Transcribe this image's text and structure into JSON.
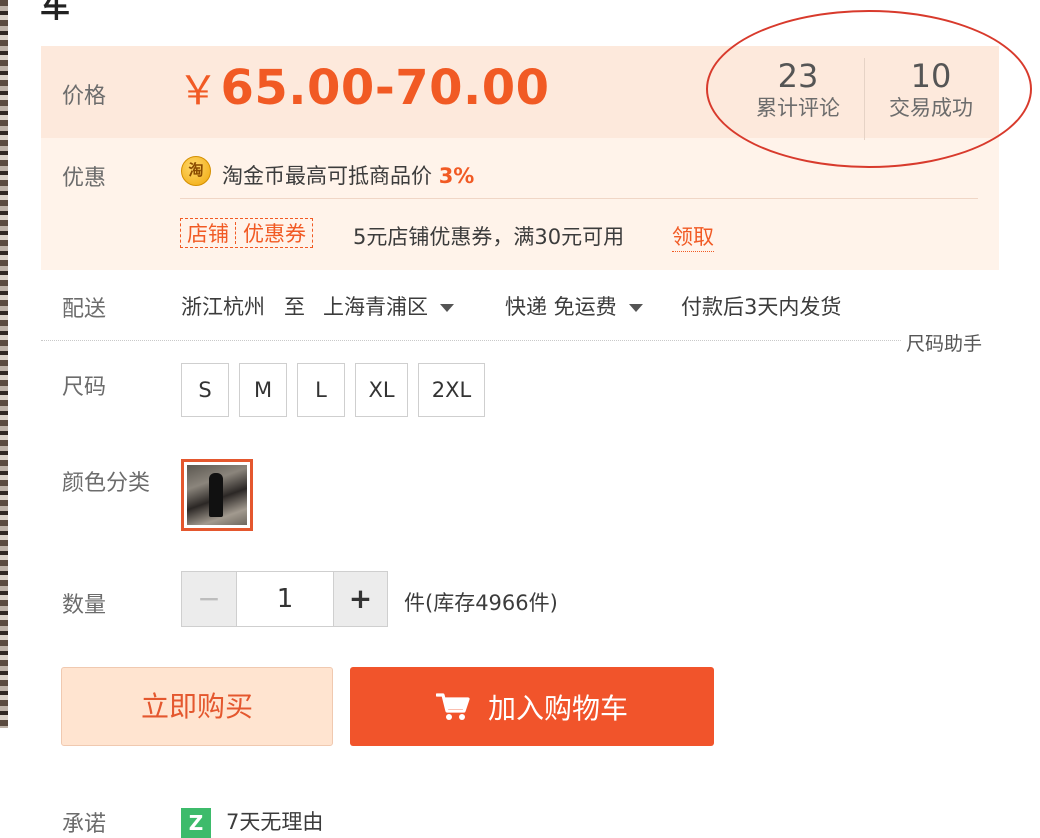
{
  "header": {
    "partial_title": "车"
  },
  "price": {
    "label": "价格",
    "currency_symbol": "￥",
    "range": "65.00-70.00"
  },
  "stats": [
    {
      "number": "23",
      "label": "累计评论"
    },
    {
      "number": "10",
      "label": "交易成功"
    }
  ],
  "promotion": {
    "label": "优惠",
    "coin_glyph": "淘",
    "coin_text": "淘金币最高可抵商品价",
    "coin_percent": "3%",
    "coupon_tag_left": "店铺",
    "coupon_tag_right": "优惠券",
    "coupon_desc": "5元店铺优惠券，满30元可用",
    "claim_label": "领取"
  },
  "shipping": {
    "label": "配送",
    "origin": "浙江杭州",
    "to": "至",
    "destination": "上海青浦区",
    "method": "快递 免运费",
    "dispatch": "付款后3天内发货"
  },
  "size": {
    "helper": "尺码助手",
    "label": "尺码",
    "options": [
      "S",
      "M",
      "L",
      "XL",
      "2XL"
    ]
  },
  "color": {
    "label": "颜色分类"
  },
  "quantity": {
    "label": "数量",
    "minus": "−",
    "value": "1",
    "plus": "+",
    "stock_text": "件(库存4966件)"
  },
  "actions": {
    "buy_now": "立即购买",
    "add_to_cart": "加入购物车"
  },
  "promise": {
    "label": "承诺",
    "icon_glyph": "Z",
    "text": "7天无理由"
  },
  "colors": {
    "accent": "#f15a24",
    "price_bg": "#fde9dc",
    "buy_bg": "#ffe4d0",
    "cart_bg": "#f1542b",
    "annotation_circle": "#d83a2c"
  }
}
